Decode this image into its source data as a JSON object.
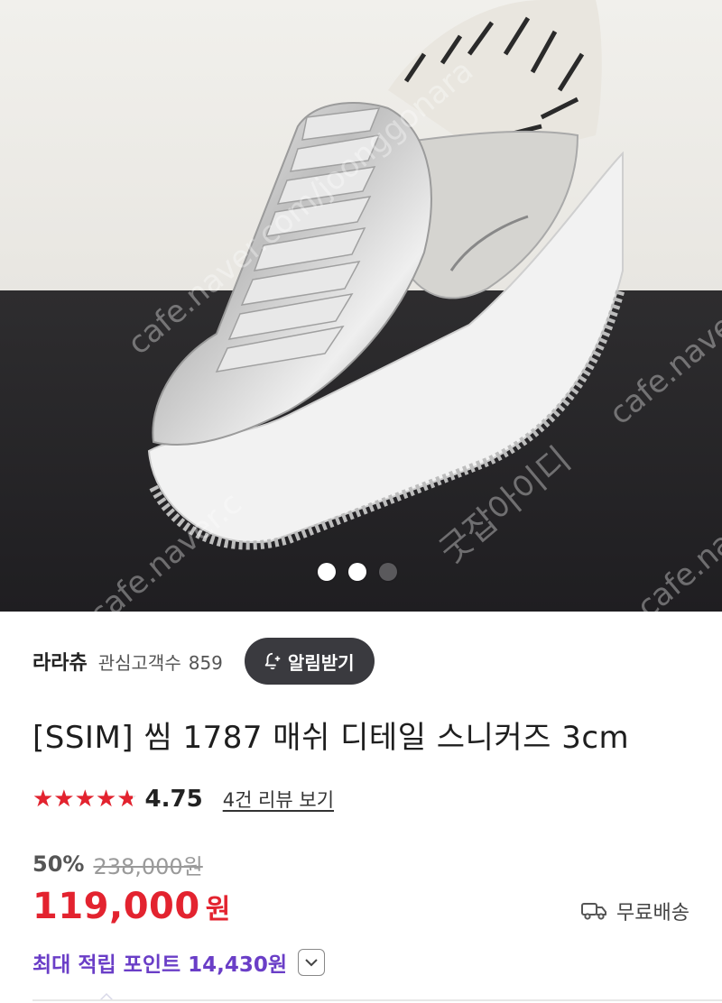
{
  "hero": {
    "watermarks": [
      "cafe.naver.com/joonggonara",
      "굿잡아이디",
      "cafe.naver.com",
      "cafe.naver.c",
      "cafe.naver"
    ],
    "carousel": {
      "total": 3,
      "active": [
        0,
        1
      ]
    }
  },
  "seller": {
    "name": "라라츄",
    "followers_label": "관심고객수",
    "followers_count": "859",
    "notify_label": "알림받기"
  },
  "product": {
    "title": "[SSIM] 씸 1787 매쉬 디테일 스니커즈 3cm",
    "rating": 4.75,
    "rating_text": "4.75",
    "review_link": "4건 리뷰 보기",
    "discount": "50%",
    "original_price": "238,000원",
    "price": "119,000",
    "currency": "원",
    "shipping": "무료배송",
    "points": "최대 적립 포인트 14,430원"
  },
  "colors": {
    "accent_red": "#e3232f",
    "points_purple": "#6a3ec7",
    "button_dark": "#3a3a3f"
  }
}
